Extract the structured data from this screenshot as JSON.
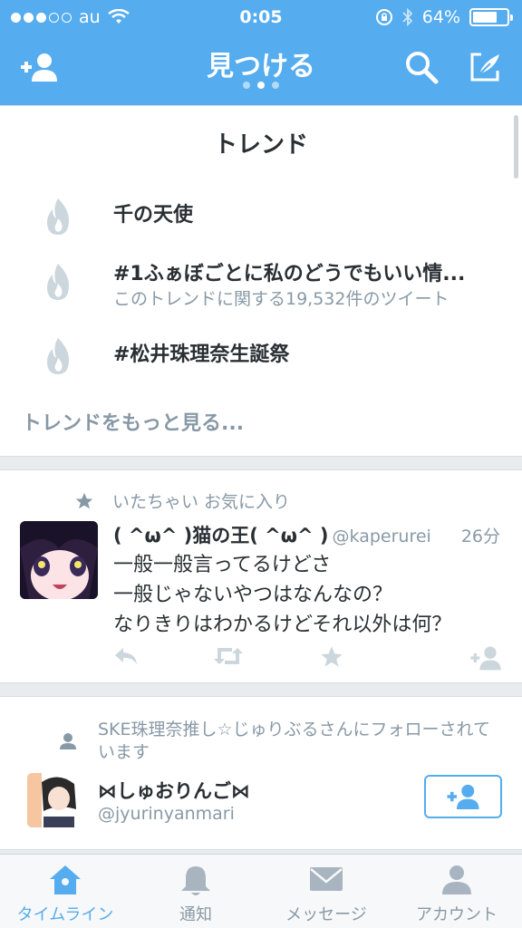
{
  "status_bar": {
    "carrier": "au",
    "time": "0:05",
    "battery": "64%",
    "battery_level": 0.64
  },
  "header": {
    "title": "見つける",
    "page_count": 3,
    "current_page": 2
  },
  "trends": {
    "title": "トレンド",
    "items": [
      {
        "name": "千の天使",
        "subtitle": ""
      },
      {
        "name": "#1ふぁぼごとに私のどうでもいい情...",
        "subtitle": "このトレンドに関する19,532件のツイート"
      },
      {
        "name": "#松井珠理奈生誕祭",
        "subtitle": ""
      }
    ],
    "more_label": "トレンドをもっと見る..."
  },
  "tweet": {
    "context": "いたちゃい お気に入り",
    "author_name": "( ^ω^ )猫の王( ^ω^ )",
    "author_handle": "@kaperurei",
    "time": "26分",
    "lines": [
      "一般一般言ってるけどさ",
      "一般じゃないやつはなんなの？",
      "なりきりはわかるけどそれ以外は何？"
    ]
  },
  "follow_suggestion": {
    "context": "SKE珠理奈推し☆じゅりぶるさんにフォローされています",
    "name": "⋈しゅおりんご⋈",
    "handle": "@jyurinyanmari"
  },
  "tabs": [
    {
      "label": "タイムライン",
      "icon": "home-icon",
      "active": true
    },
    {
      "label": "通知",
      "icon": "bell-icon",
      "active": false
    },
    {
      "label": "メッセージ",
      "icon": "envelope-icon",
      "active": false
    },
    {
      "label": "アカウント",
      "icon": "person-icon",
      "active": false
    }
  ],
  "colors": {
    "accent": "#55acee",
    "muted": "#8899a6",
    "text": "#292f33"
  }
}
